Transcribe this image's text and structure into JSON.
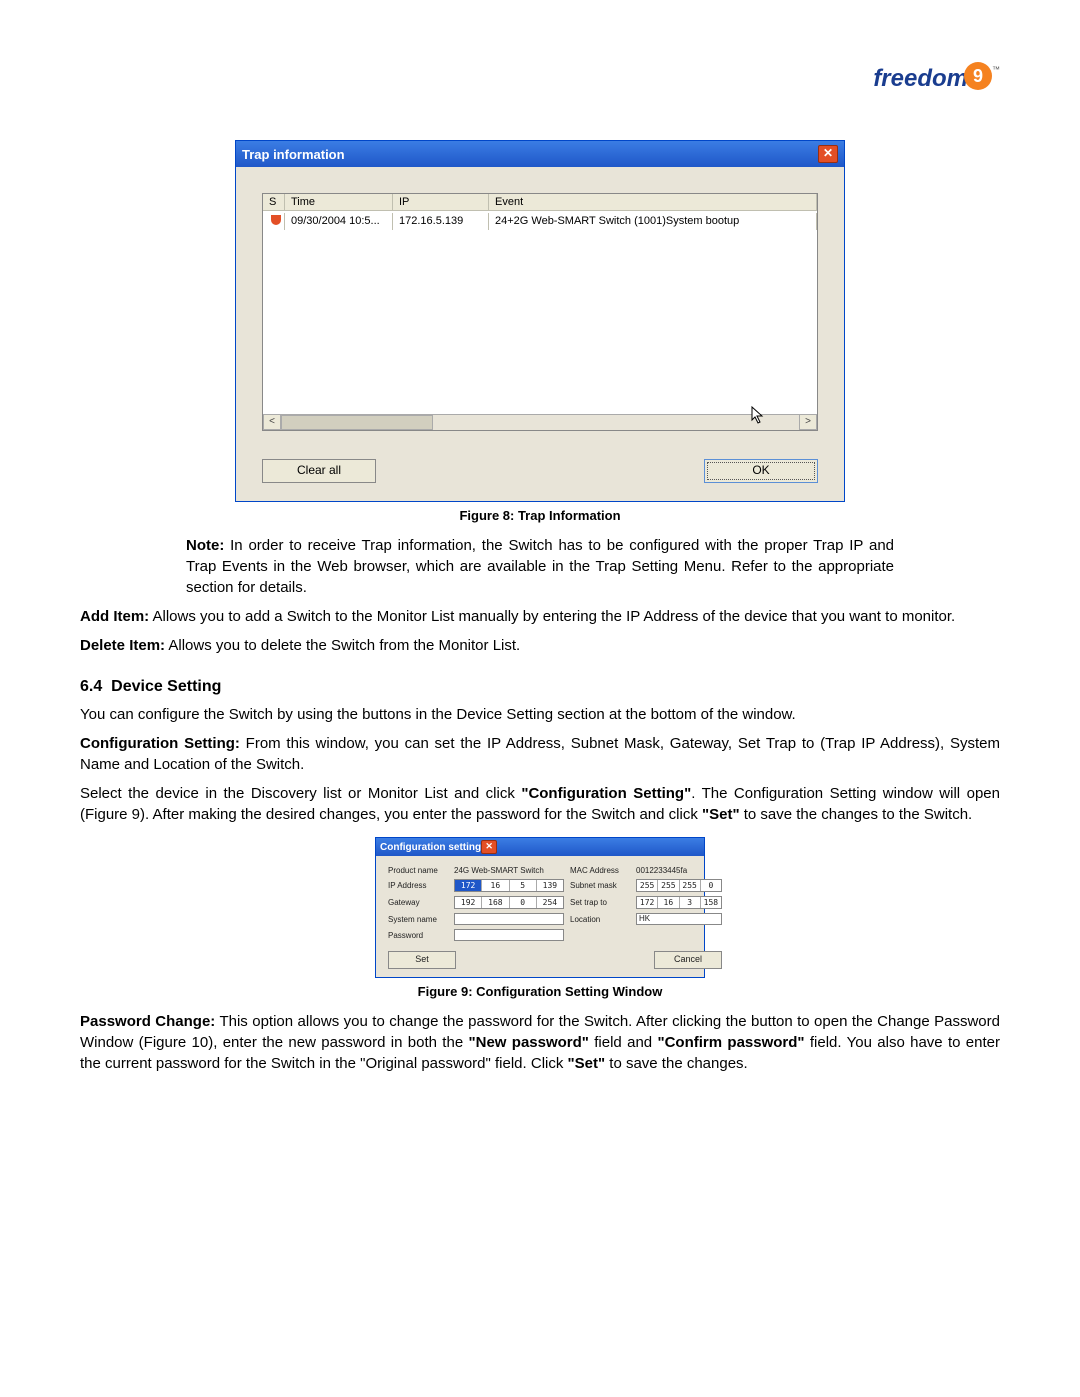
{
  "logo": {
    "text": "freedom",
    "glyph": "9",
    "tm": "™"
  },
  "fig8": {
    "window_title": "Trap information",
    "columns": {
      "s": "S",
      "time": "Time",
      "ip": "IP",
      "event": "Event"
    },
    "row": {
      "time": "09/30/2004 10:5...",
      "ip": "172.16.5.139",
      "event": "24+2G Web-SMART Switch (1001)System bootup"
    },
    "clear_all": "Clear all",
    "ok": "OK",
    "caption": "Figure 8: Trap Information"
  },
  "note": {
    "label": "Note:",
    "text": " In order to receive Trap information, the Switch has to be configured with the proper Trap IP and Trap Events in the Web browser, which are available in the Trap Setting Menu.  Refer to the appropriate section for details."
  },
  "add_item": {
    "label": "Add Item:",
    "text": " Allows you to add a Switch to the Monitor List manually by entering the IP Address of the device that you want to monitor."
  },
  "delete_item": {
    "label": "Delete Item:",
    "text": " Allows you to delete the Switch from the Monitor List."
  },
  "section64": {
    "num": "6.4",
    "title": "Device Setting",
    "p1": "You can configure the Switch by using the buttons in the Device Setting section at the bottom of the window.",
    "config_label": "Configuration Setting:",
    "config_text": " From this window, you can set the IP Address, Subnet Mask, Gateway, Set Trap to (Trap IP Address), System Name and Location of the Switch.",
    "p2a": "Select the device in the Discovery list or Monitor List and click ",
    "p2b": "\"Configuration Setting\"",
    "p2c": ".  The Configuration Setting window will open (Figure 9).  After making the desired changes, you enter the password for the Switch and click ",
    "p2d": "\"Set\"",
    "p2e": " to save the changes to the Switch."
  },
  "fig9": {
    "window_title": "Configuration setting",
    "labels": {
      "product": "Product name",
      "ip": "IP Address",
      "gateway": "Gateway",
      "sysname": "System name",
      "password": "Password",
      "mac": "MAC Address",
      "subnet": "Subnet mask",
      "settrap": "Set trap to",
      "location": "Location"
    },
    "values": {
      "product": "24G Web-SMART Switch",
      "mac": "0012233445fa",
      "ip": [
        "172",
        "16",
        "5",
        "139"
      ],
      "subnet": [
        "255",
        "255",
        "255",
        "0"
      ],
      "gateway": [
        "192",
        "168",
        "0",
        "254"
      ],
      "settrap": [
        "172",
        "16",
        "3",
        "158"
      ],
      "location": "HK"
    },
    "set": "Set",
    "cancel": "Cancel",
    "caption": "Figure 9: Configuration Setting Window"
  },
  "pwchange": {
    "label": "Password Change:",
    "t1": " This option allows you to change the password for the Switch.  After clicking the button to open the Change Password Window (Figure 10), enter the new password in both the ",
    "b1": "\"New password\"",
    "t2": " field and ",
    "b2": "\"Confirm password\"",
    "t3": " field.  You also have to enter the current password for the Switch in the \"Original password\" field.  Click ",
    "b3": "\"Set\"",
    "t4": " to save the changes."
  }
}
